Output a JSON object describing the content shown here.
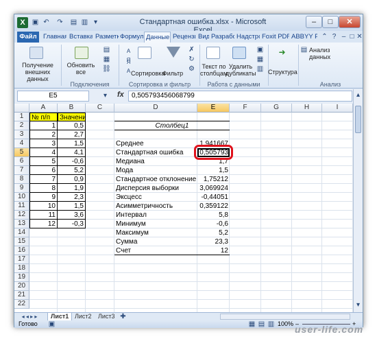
{
  "window": {
    "title": "Стандартная ошибка.xlsx - Microsoft Excel",
    "minimize": "–",
    "maximize": "□",
    "close": "✕"
  },
  "tabs": [
    "Файл",
    "Главная",
    "Вставка",
    "Разметка",
    "Формуль",
    "Данные",
    "Рецензи",
    "Вид",
    "Разрабо",
    "Надстро",
    "Foxit PDF",
    "ABBYY PI"
  ],
  "active_tab": "Данные",
  "ribbon": {
    "get_external": "Получение внешних данных",
    "refresh_all": "Обновить все",
    "group_connections": "Подключения",
    "sort": "Сортировка",
    "filter": "Фильтр",
    "group_sort_filter": "Сортировка и фильтр",
    "text_to_columns": "Текст по столбцам",
    "remove_duplicates": "Удалить дубликаты",
    "group_data_tools": "Работа с данными",
    "outline": "Структура",
    "data_analysis": "Анализ данных",
    "group_analysis": "Анализ",
    "sort_az": "А Я",
    "sort_za": "Я А"
  },
  "formula_bar": {
    "name_box": "E5",
    "fx": "fx",
    "formula": "0,505793456068799"
  },
  "columns": [
    "A",
    "B",
    "C",
    "D",
    "E",
    "F",
    "G",
    "H",
    "I"
  ],
  "rows": [
    "1",
    "2",
    "3",
    "4",
    "5",
    "6",
    "7",
    "8",
    "9",
    "10",
    "11",
    "12",
    "13",
    "14",
    "15",
    "16",
    "17",
    "18",
    "19",
    "20",
    "21",
    "22"
  ],
  "table": {
    "header_a": "№ п/п",
    "header_b": "Значение",
    "a": [
      "1",
      "2",
      "3",
      "4",
      "5",
      "6",
      "7",
      "8",
      "9",
      "10",
      "11",
      "12"
    ],
    "b": [
      "0,5",
      "2,7",
      "1,5",
      "4,1",
      "-0,6",
      "5,2",
      "0,9",
      "1,9",
      "2,3",
      "1,5",
      "3,6",
      "-0,3"
    ]
  },
  "stats": {
    "title": "Столбец1",
    "labels": [
      "Среднее",
      "Стандартная ошибка",
      "Медиана",
      "Мода",
      "Стандартное отклонение",
      "Дисперсия выборки",
      "Эксцесс",
      "Асимметричность",
      "Интервал",
      "Минимум",
      "Максимум",
      "Сумма",
      "Счет"
    ],
    "values": [
      "1,941667",
      "0,505793",
      "1,7",
      "1,5",
      "1,75212",
      "3,069924",
      "-0,44051",
      "0,359122",
      "5,8",
      "-0,6",
      "5,2",
      "23,3",
      "12"
    ]
  },
  "sheets": [
    "Лист1",
    "Лист2",
    "Лист3"
  ],
  "status": {
    "ready": "Готово",
    "zoom": "100%",
    "zoom_minus": "–",
    "zoom_plus": "+"
  },
  "colors": {
    "highlight_yellow": "#ffff00",
    "selection_red": "#e0121c",
    "ribbon_blue": "#2a67b1"
  },
  "watermark": "user-life.com"
}
